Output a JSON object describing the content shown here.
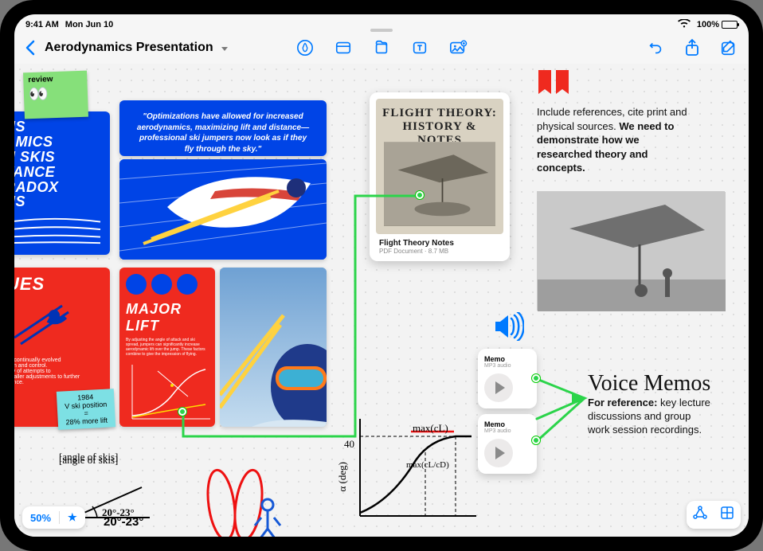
{
  "statusbar": {
    "time": "9:41 AM",
    "date": "Mon Jun 10",
    "battery_pct": "100%"
  },
  "toolbar": {
    "title": "Aerodynamics Presentation"
  },
  "sticky_review": {
    "label": "review",
    "emoji": "👀"
  },
  "slide_blue_left": {
    "l1": "NS",
    "l2": "AMICS",
    "l3": "N SKIS",
    "l4": "TANCE",
    "l5": "RADOX",
    "l6": "NS"
  },
  "quote": "\"Optimizations have allowed for increased aerodynamics, maximizing lift and distance—professional ski jumpers now look as if they fly through the sky.\"",
  "slide_red_left": {
    "header": "UES",
    "body": "as continually evolved\nsion and control.\nany of attempts to\nsmaller adjustments to further\nrrence."
  },
  "sticky_cyan": {
    "l1": "1984",
    "l2": "V ski position",
    "l3": "=",
    "l4": "28% more lift"
  },
  "slide_red_major": {
    "title": "MAJOR LIFT",
    "body": "By adjusting the angle of attack and ski spread, jumpers can significantly increase aerodynamic lift over the jump. These factors combine to give the impression of flying."
  },
  "doc": {
    "cover_title": "FLIGHT THEORY: HISTORY & NOTES",
    "name": "Flight Theory Notes",
    "sub": "PDF Document · 8.7 MB"
  },
  "references_block": {
    "plain": "Include references, cite print and physical sources.",
    "bold": "We need to demonstrate how we researched theory and concepts."
  },
  "voice": {
    "heading": "Voice Memos",
    "lead": "For reference:",
    "rest": " key lecture discussions and group work session recordings."
  },
  "memo1": {
    "title": "Memo",
    "sub": "MP3 audio"
  },
  "memo2": {
    "title": "Memo",
    "sub": "MP3 audio"
  },
  "sketch": {
    "angle_label": "[angle of skis]",
    "angle_range": "20°-23°",
    "y_axis": "α (deg)",
    "y_tick": "40",
    "label_top": "max(cL)",
    "label_mid": "max(cL/cD)"
  },
  "zoom": {
    "pct": "50%",
    "star": "★"
  }
}
